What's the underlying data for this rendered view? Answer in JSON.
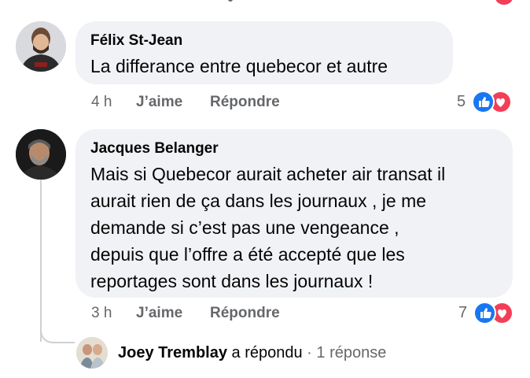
{
  "comments": [
    {
      "author": "Félix St-Jean",
      "text": "La differance entre quebecor et autre",
      "time": "4 h",
      "like_label": "J’aime",
      "reply_label": "Répondre",
      "reaction_count": "5",
      "reactions": [
        "like-icon",
        "love-icon"
      ]
    },
    {
      "author": "Jacques Belanger",
      "text_lines": [
        "Mais si Quebecor aurait acheter air transat il",
        "aurait rien de ça dans les journaux , je me",
        "demande si c’est pas une vengeance ,",
        "depuis que l’offre a été accepté que les",
        "reportages sont dans les journaux !"
      ],
      "time": "3 h",
      "like_label": "J’aime",
      "reply_label": "Répondre",
      "reaction_count": "7",
      "reactions": [
        "like-icon",
        "love-icon"
      ]
    }
  ],
  "reply_summary": {
    "author": "Joey Tremblay",
    "action": "a répondu",
    "separator": "·",
    "count_text": "1 réponse"
  },
  "colors": {
    "bubble": "#f0f2f5",
    "meta": "#65676b",
    "like": "#1877f2",
    "love": "#f33e58"
  }
}
